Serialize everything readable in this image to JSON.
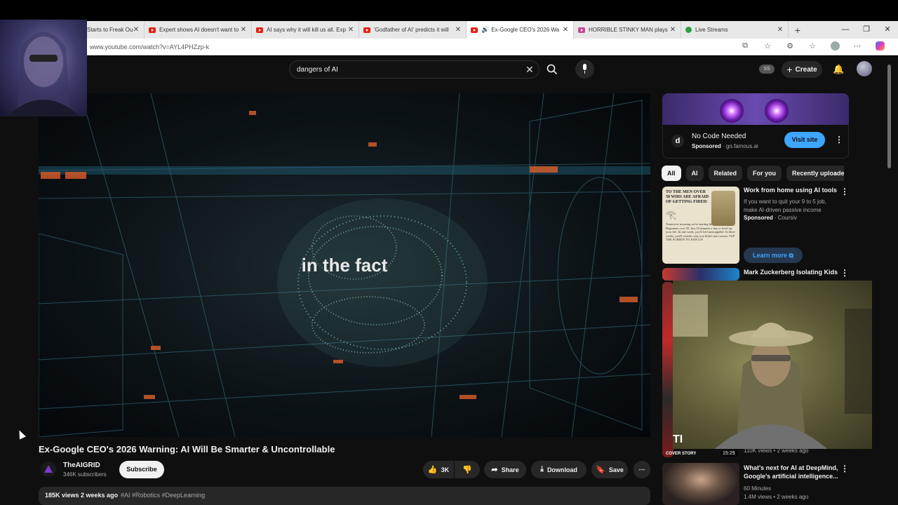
{
  "browser": {
    "tabs": [
      {
        "title": "Starts to Freak Out an",
        "active": false
      },
      {
        "title": "Expert shows AI doesn't want to",
        "active": false
      },
      {
        "title": "AI says why it will kill us all. Exp",
        "active": false
      },
      {
        "title": "'Godfather of AI' predicts it will",
        "active": false
      },
      {
        "title": "Ex-Google CEO's 2026 Wa",
        "active": true
      },
      {
        "title": "HORRIBLE STINKY MAN plays T",
        "active": false
      },
      {
        "title": "Live Streams",
        "active": false
      }
    ],
    "url": "www.youtube.com/watch?v=AYL4PHZzp-k"
  },
  "youtube": {
    "search_query": "dangers of AI",
    "user_badge": "SS",
    "create_label": "Create",
    "player": {
      "caption": "in the fact"
    },
    "video": {
      "title": "Ex-Google CEO's 2026 Warning: AI Will Be Smarter & Uncontrollable",
      "channel": "TheAIGRID",
      "subscribers": "346K subscribers",
      "subscribe_label": "Subscribe",
      "likes": "3K",
      "share_label": "Share",
      "download_label": "Download",
      "save_label": "Save",
      "views_date": "185K views  2 weeks ago",
      "hashtags": "#AI #Robotics #DeepLearning"
    },
    "ad_top": {
      "title": "No Code Needed",
      "sponsored": "Sponsored",
      "domain": "go.famous.ai",
      "logo_text": "d",
      "button": "Visit site"
    },
    "chips": [
      "All",
      "AI",
      "Related",
      "For you",
      "Recently uploaded"
    ],
    "ad_card": {
      "thumb_headline": "TO THE MEN OVER 50 WHO ARE AFRAID OF GETTING FIRED:",
      "thumb_body": "Tomorrow morning we're starting the AI Course for Beginners over 50. Just 10 minutes a day to level up your life. In one week, you'll feel unstoppable. In three weeks, you'll wonder why you didn't start sooner. TAP THE SCREEN TO JOIN US!",
      "title": "Work from home using AI tools",
      "desc": "If you want to quit your 9 to 5 job, make AI-driven passive income",
      "sponsored": "Sponsored",
      "advertiser": "Coursiv",
      "button": "Learn more"
    },
    "recommendations": [
      {
        "title": "Mark Zuckerberg Isolating Kids",
        "meta": "",
        "duration": ""
      },
      {
        "title": "",
        "meta": "110K views • 2 weeks ago",
        "duration": "15:29",
        "badge": "COVER STORY"
      },
      {
        "title": "What's next for AI at DeepMind, Google's artificial intelligence...",
        "channel": "60 Minutes",
        "meta": "1.4M views • 2 weeks ago",
        "duration": ""
      }
    ],
    "webcam_overlay_text": "TI"
  }
}
